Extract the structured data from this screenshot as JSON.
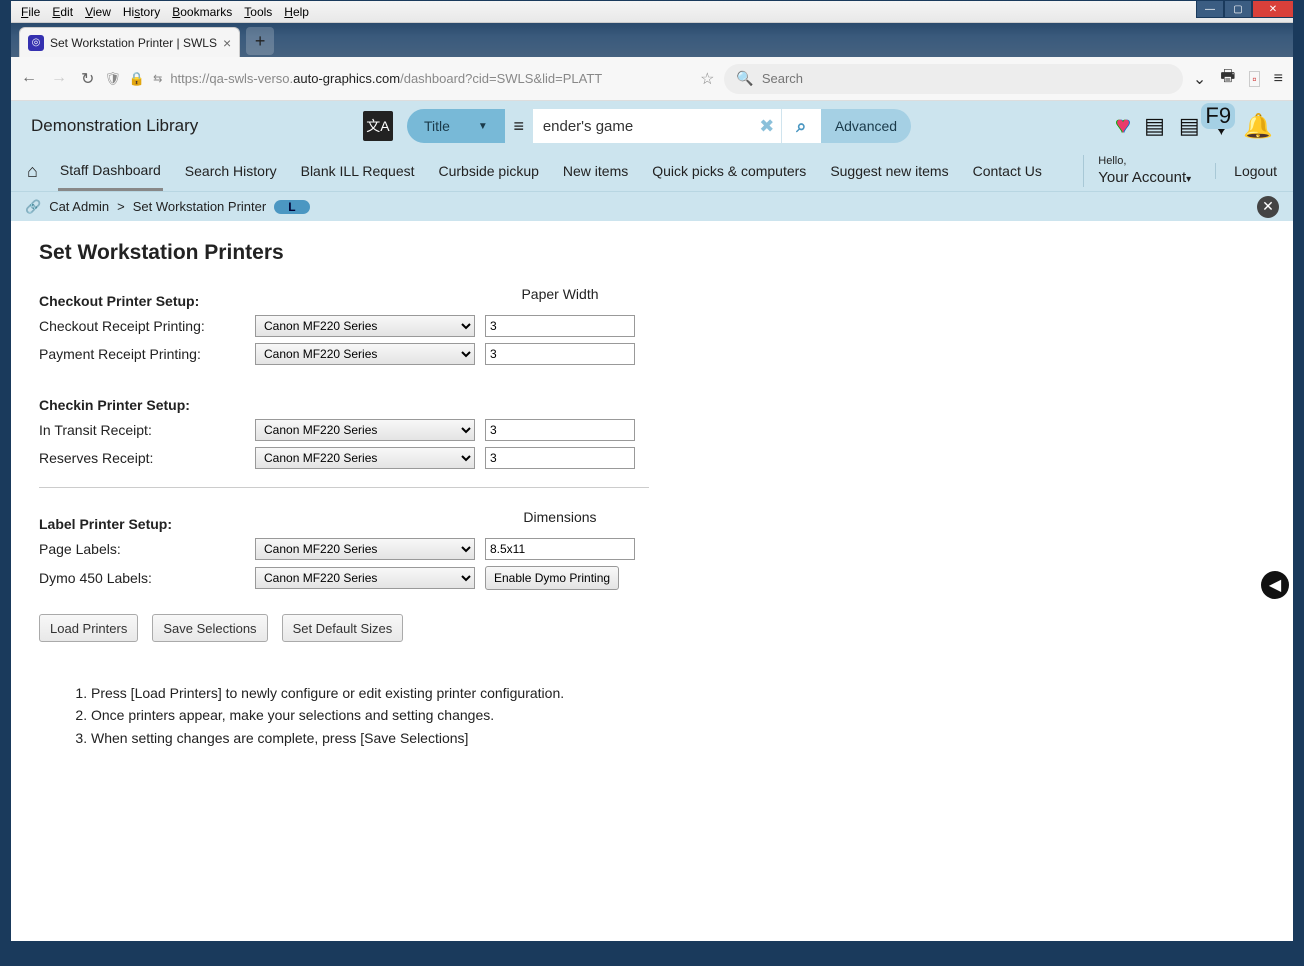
{
  "os_menu": [
    "File",
    "Edit",
    "View",
    "History",
    "Bookmarks",
    "Tools",
    "Help"
  ],
  "window_controls": {
    "min": "—",
    "max": "▢",
    "close": "✕"
  },
  "tab": {
    "title": "Set Workstation Printer | SWLS"
  },
  "address": {
    "back": "←",
    "fwd": "→",
    "reload": "↻",
    "url_pre": "https://qa-swls-verso.",
    "url_dark": "auto-graphics.com",
    "url_post": "/dashboard?cid=SWLS&lid=PLATT"
  },
  "browser_search_placeholder": "Search",
  "header": {
    "library_name": "Demonstration Library",
    "search_type": "Title",
    "query": "ender's game",
    "advanced": "Advanced",
    "f9": "F9"
  },
  "nav": {
    "items": [
      "Staff Dashboard",
      "Search History",
      "Blank ILL Request",
      "Curbside pickup",
      "New items",
      "Quick picks & computers",
      "Suggest new items",
      "Contact Us"
    ],
    "hello": "Hello,",
    "account": "Your Account",
    "logout": "Logout"
  },
  "breadcrumb": {
    "a": "Cat Admin",
    "b": "Set Workstation Printer",
    "badge": "L"
  },
  "page": {
    "title": "Set Workstation Printers",
    "checkout_head": "Checkout Printer Setup:",
    "paper_width": "Paper Width",
    "checkout_label": "Checkout Receipt Printing:",
    "payment_label": "Payment Receipt Printing:",
    "checkin_head": "Checkin Printer Setup:",
    "intransit_label": "In Transit Receipt:",
    "reserves_label": "Reserves Receipt:",
    "label_head": "Label Printer Setup:",
    "dimensions": "Dimensions",
    "page_labels": "Page Labels:",
    "dymo_labels": "Dymo 450 Labels:",
    "printer_option": "Canon MF220 Series",
    "width_val": "3",
    "dim_val": "8.5x11",
    "enable_dymo": "Enable Dymo Printing",
    "load_btn": "Load Printers",
    "save_btn": "Save Selections",
    "default_btn": "Set Default Sizes",
    "instr1": "Press [Load Printers] to newly configure or edit existing printer configuration.",
    "instr2": "Once printers appear, make your selections and setting changes.",
    "instr3": "When setting changes are complete, press [Save Selections]"
  }
}
